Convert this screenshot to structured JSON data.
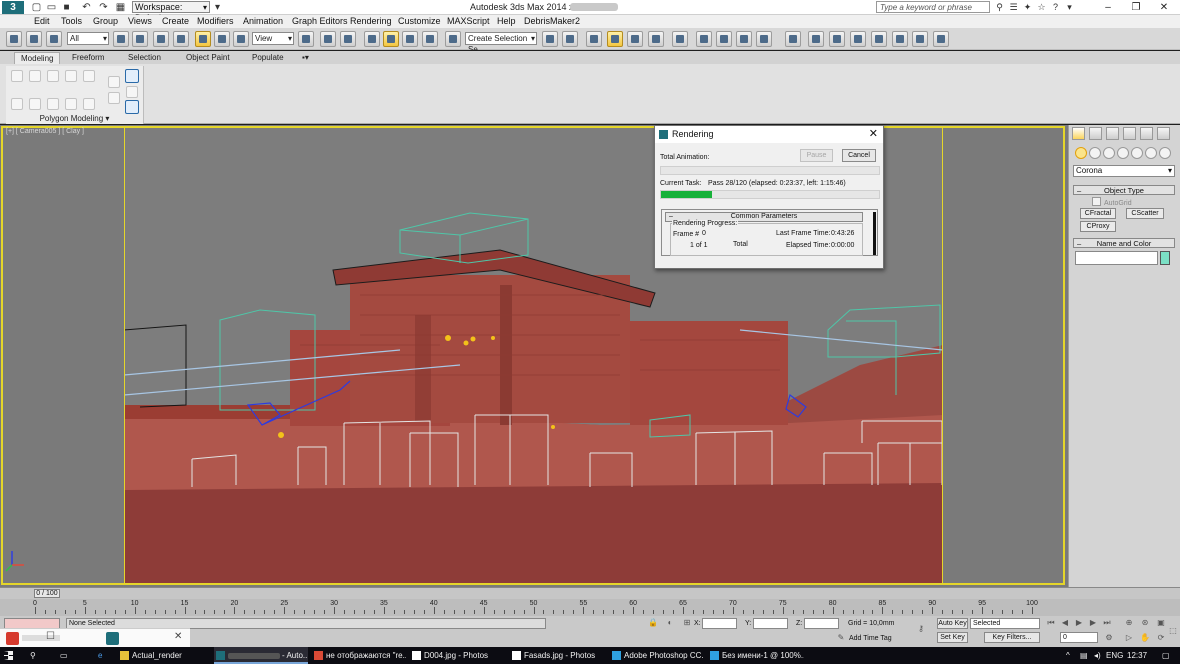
{
  "title_bar": {
    "workspace": "Workspace: Default",
    "title": "Autodesk 3ds Max  2014 x64",
    "search_placeholder": "Type a keyword or phrase",
    "quick_access": [
      "new-file-icon",
      "open-icon",
      "save-icon",
      "undo-icon",
      "redo-icon",
      "project-folder-icon"
    ]
  },
  "menu": [
    "Edit",
    "Tools",
    "Group",
    "Views",
    "Create",
    "Modifiers",
    "Animation",
    "Graph Editors",
    "Rendering",
    "Customize",
    "MAXScript",
    "Help",
    "DebrisMaker2"
  ],
  "toolbar": {
    "selection_filter": "All",
    "reference_coord": "View",
    "named_selection_placeholder": "Create Selection Se"
  },
  "ribbon": {
    "tabs": [
      "Modeling",
      "Freeform",
      "Selection",
      "Object Paint",
      "Populate"
    ],
    "active_tab": "Modeling",
    "panel_label": "Polygon Modeling"
  },
  "viewport": {
    "label": "[+] [ Camera005 ] [ Clay ]"
  },
  "command_panel": {
    "renderer": "Corona",
    "object_type_title": "Object Type",
    "autogrid": "AutoGrid",
    "buttons": [
      "CFractal",
      "CScatter",
      "CProxy"
    ],
    "name_color_title": "Name and Color",
    "swatch_color": "#7be0c5"
  },
  "render_dialog": {
    "title": "Rendering",
    "pause": "Pause",
    "cancel": "Cancel",
    "total_animation_label": "Total Animation:",
    "current_task_label": "Current Task:",
    "current_task": "Pass 28/120 (elapsed: 0:23:37, left: 1:15:46)",
    "progress": 0.233,
    "section": "Common Parameters",
    "rendering_progress": "Rendering Progress:",
    "frame_label": "Frame #",
    "frame_value": "0",
    "frames": "1 of 1",
    "total": "Total",
    "last_frame_time_label": "Last Frame Time:",
    "last_frame_time": "0:43:26",
    "elapsed_time_label": "Elapsed Time:",
    "elapsed_time": "0:00:00"
  },
  "timeline": {
    "frame": "0 / 100",
    "labels": [
      "0",
      "5",
      "10",
      "15",
      "20",
      "25",
      "30",
      "35",
      "40",
      "45",
      "50",
      "55",
      "60",
      "65",
      "70",
      "75",
      "80",
      "85",
      "90",
      "95",
      "100"
    ]
  },
  "status_bar": {
    "selection": "None Selected",
    "x_label": "X:",
    "y_label": "Y:",
    "z_label": "Z:",
    "grid": "Grid = 10,0mm",
    "add_time_tag": "Add Time Tag",
    "auto_key": "Auto Key",
    "set_key": "Set Key",
    "selected": "Selected",
    "key_filters": "Key Filters...",
    "frame_field": "0"
  },
  "taskbar": {
    "items": [
      {
        "label": "Actual_render",
        "icon_color": "#e6c23a",
        "active": false
      },
      {
        "label": "- Auto...",
        "icon_color": "#1e6e7a",
        "active": true
      },
      {
        "label": "не отображаются \"re...",
        "icon_color": "#d94a36",
        "active": false
      },
      {
        "label": "D004.jpg - Photos",
        "icon_color": "#ffffff",
        "active": false
      },
      {
        "label": "Fasads.jpg - Photos",
        "icon_color": "#ffffff",
        "active": false
      },
      {
        "label": "Adobe Photoshop CC...",
        "icon_color": "#2fa1e0",
        "active": false
      },
      {
        "label": "Без имени-1 @ 100%...",
        "icon_color": "#2fa1e0",
        "active": false
      }
    ],
    "lang": "ENG",
    "time": "12:37"
  }
}
